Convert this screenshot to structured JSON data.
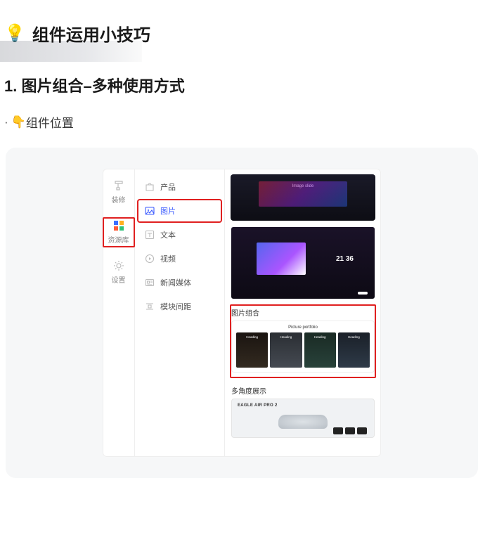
{
  "page": {
    "title": "组件运用小技巧",
    "bulb_emoji": "💡"
  },
  "section": {
    "heading": "1. 图片组合–多种使用方式",
    "location_label": "组件位置",
    "pointer_emoji": "👇"
  },
  "app": {
    "primary_rail": [
      {
        "id": "decorate",
        "label": "装修",
        "icon": "brush-icon"
      },
      {
        "id": "library",
        "label": "资源库",
        "icon": "grid-icon",
        "selected": true,
        "highlight_red": true
      },
      {
        "id": "settings",
        "label": "设置",
        "icon": "gear-icon"
      }
    ],
    "components": [
      {
        "id": "product",
        "label": "产品",
        "icon": "bag-icon"
      },
      {
        "id": "image",
        "label": "图片",
        "icon": "image-icon",
        "selected": true,
        "highlight_red": true
      },
      {
        "id": "text",
        "label": "文本",
        "icon": "text-icon"
      },
      {
        "id": "video",
        "label": "视频",
        "icon": "play-icon"
      },
      {
        "id": "news",
        "label": "新闻媒体",
        "icon": "news-icon"
      },
      {
        "id": "spacing",
        "label": "模块间距",
        "icon": "spacing-icon"
      }
    ],
    "preview": {
      "laptop_caption": "Image slide",
      "monitor_clock": "21 36",
      "portfolio_section_label": "图片组合",
      "portfolio_title": "Picture portfolio",
      "portfolio_tile_caption": "Heading",
      "portfolio_highlight_red": true,
      "multi_section_label": "多角度展示",
      "multi_brand": "EAGLE AIR PRO 2"
    }
  }
}
